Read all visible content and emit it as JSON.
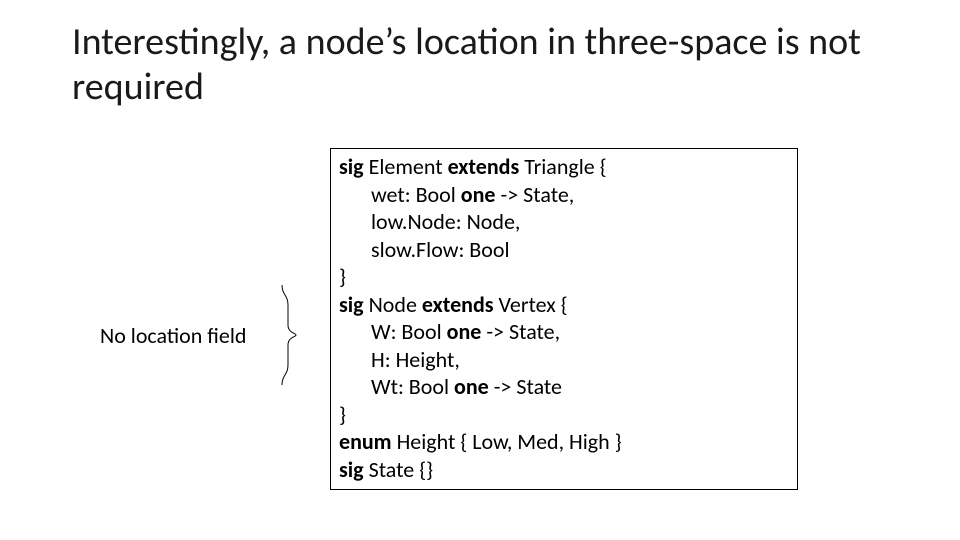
{
  "title": "Interestingly, a node’s location in three-space is not required",
  "annotation": "No location field",
  "code": {
    "l1a": "sig",
    "l1b": " Element ",
    "l1c": "extends",
    "l1d": " Triangle {",
    "l2a": "wet: Bool ",
    "l2b": "one",
    "l2c": " -> State,",
    "l3": "low.Node: Node,",
    "l4": "slow.Flow: Bool",
    "l5": "}",
    "l6a": "sig",
    "l6b": " Node ",
    "l6c": "extends",
    "l6d": " Vertex {",
    "l7a": "W: Bool ",
    "l7b": "one",
    "l7c": " -> State,",
    "l8": "H: Height,",
    "l9a": "Wt: Bool ",
    "l9b": "one",
    "l9c": " -> State",
    "l10": "}",
    "l11a": "enum",
    "l11b": " Height { Low, Med, High }",
    "l12a": "sig",
    "l12b": " State {}"
  }
}
